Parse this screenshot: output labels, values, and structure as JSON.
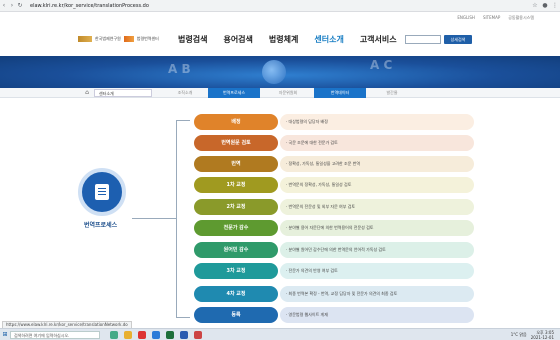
{
  "browser": {
    "url": "elaw.klri.re.kr/kor_service/translationProcess.do"
  },
  "topmeta": [
    "ENGLISH",
    "SITEMAP",
    "공동활용시스템"
  ],
  "logo": {
    "text1": "한국법제연구원",
    "text2": "법령번역센터"
  },
  "gnb": [
    "법령검색",
    "용어검색",
    "법령체계",
    "센터소개",
    "고객서비스"
  ],
  "gnb_active_index": 3,
  "search": {
    "button": "상세검색"
  },
  "subnav": {
    "home_icon": "home-icon",
    "dropdown": "센터소개",
    "tabs": [
      "조직소개",
      "번역프로세스",
      "자문위원회",
      "번역데이터",
      "발간물"
    ],
    "active": [
      1,
      3
    ]
  },
  "flow": {
    "label": "번역프로세스"
  },
  "steps": [
    {
      "label": "배정",
      "desc": "· 대상법령의 담당자 배정",
      "color": "#e0832a",
      "bg": "#fbeee2"
    },
    {
      "label": "번역원문 검토",
      "desc": "· 국문 조문에 대한 전문가 검토",
      "color": "#c8672a",
      "bg": "#f8e6dc"
    },
    {
      "label": "번역",
      "desc": "· 정확성, 가독성, 통일성을 고려한 조문 번역",
      "color": "#b07a20",
      "bg": "#f6ecda"
    },
    {
      "label": "1차 교정",
      "desc": "· 번역문의 정확성, 가독성, 통일성 검토",
      "color": "#a09a20",
      "bg": "#f4f2da"
    },
    {
      "label": "2차 교정",
      "desc": "· 번역문의 전문성 및 외부 자문 여부 검토",
      "color": "#8a9a2a",
      "bg": "#eef2dc"
    },
    {
      "label": "전문가 감수",
      "desc": "· 분야별 용어 자문단에 의한 번역용어의 전문성 검토",
      "color": "#5e9a30",
      "bg": "#e6f0dc"
    },
    {
      "label": "원어민 감수",
      "desc": "· 분야별 원어민 감수단에 의한 번역문의 언어적 가독성 검토",
      "color": "#2f9a6a",
      "bg": "#dcf0e8"
    },
    {
      "label": "3차 교정",
      "desc": "· 전문가 의견의 반영 여부 검토",
      "color": "#1f9a9a",
      "bg": "#dcf0f0"
    },
    {
      "label": "4차 교정",
      "desc": "· 최종 번역본 확정 - 번역, 교정 담당자 및 전문가 의견의 최종 검토",
      "color": "#1f8ab0",
      "bg": "#dceaf2"
    },
    {
      "label": "등록",
      "desc": "· 영문법령 웹사이트 게재",
      "color": "#1f6ab0",
      "bg": "#dce4f2"
    }
  ],
  "status_url": "https://www.elaw.klri.re.kr/kor_service/translationNetwork.do",
  "taskbar": {
    "search": "검색하려면 여기에 입력하십시오.",
    "weather": "1°C 맑음",
    "time": "오후 3:05",
    "date": "2021-12-01"
  }
}
